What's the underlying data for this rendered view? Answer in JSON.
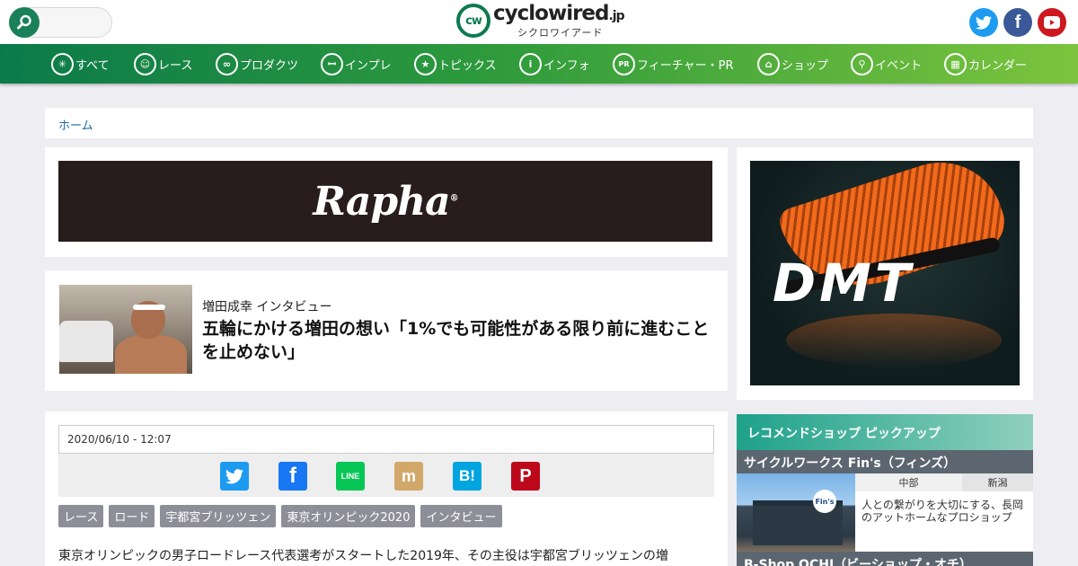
{
  "header": {
    "search_placeholder": "",
    "logo_mark": "cw",
    "logo_name": "cyclowired",
    "logo_tld": ".jp",
    "logo_sub": "シクロワイアード",
    "social": [
      {
        "name": "twitter",
        "glyph": ""
      },
      {
        "name": "facebook",
        "glyph": "f"
      },
      {
        "name": "youtube",
        "glyph": "▶"
      }
    ]
  },
  "nav": {
    "items": [
      {
        "label": "すべて",
        "icon": "asterisk-icon",
        "glyph": "✳"
      },
      {
        "label": "レース",
        "icon": "cyclist-icon",
        "glyph": "☺"
      },
      {
        "label": "プロダクツ",
        "icon": "bike-icon",
        "glyph": "∞"
      },
      {
        "label": "インプレ",
        "icon": "impression-icon",
        "glyph": "ꟷ"
      },
      {
        "label": "トピックス",
        "icon": "star-icon",
        "glyph": "★"
      },
      {
        "label": "インフォ",
        "icon": "info-icon",
        "glyph": "i"
      },
      {
        "label": "フィーチャー・PR",
        "icon": "pr-icon",
        "glyph": "PR"
      },
      {
        "label": "ショップ",
        "icon": "shop-icon",
        "glyph": "⌂"
      },
      {
        "label": "イベント",
        "icon": "location-pin-icon",
        "glyph": "⚲"
      },
      {
        "label": "カレンダー",
        "icon": "calendar-icon",
        "glyph": "▦"
      }
    ]
  },
  "breadcrumb": {
    "home": "ホーム"
  },
  "ads": {
    "rapha": "Rapha",
    "rapha_mark": "®",
    "dmt": "DMT"
  },
  "card": {
    "kicker": "増田成幸 インタビュー",
    "title": "五輪にかける増田の想い「1%でも可能性がある限り前に進むことを止めない」"
  },
  "article": {
    "date": "2020/06/10 - 12:07",
    "share": [
      {
        "name": "twitter",
        "glyph": "🐦"
      },
      {
        "name": "facebook",
        "glyph": "f"
      },
      {
        "name": "line",
        "glyph": "LINE"
      },
      {
        "name": "mixi",
        "glyph": "m"
      },
      {
        "name": "hatena",
        "glyph": "B!"
      },
      {
        "name": "pinterest",
        "glyph": "P"
      }
    ],
    "tags": [
      "レース",
      "ロード",
      "宇都宮ブリッツェン",
      "東京オリンピック2020",
      "インタビュー"
    ],
    "lead": "東京オリンピックの男子ロードレース代表選考がスタートした2019年、その主役は宇都宮ブリッツェンの増"
  },
  "shop": {
    "heading": "レコメンドショップ ピックアップ",
    "name": "サイクルワークス Fin's（フィンズ）",
    "region": "中部",
    "prefecture": "新潟",
    "description": "人との繋がりを大切にする、長岡のアットホームなプロショップ",
    "photo_sign": "Fin's",
    "next_name": "B-Shop OCHI（ビーショップ・オチ）"
  }
}
